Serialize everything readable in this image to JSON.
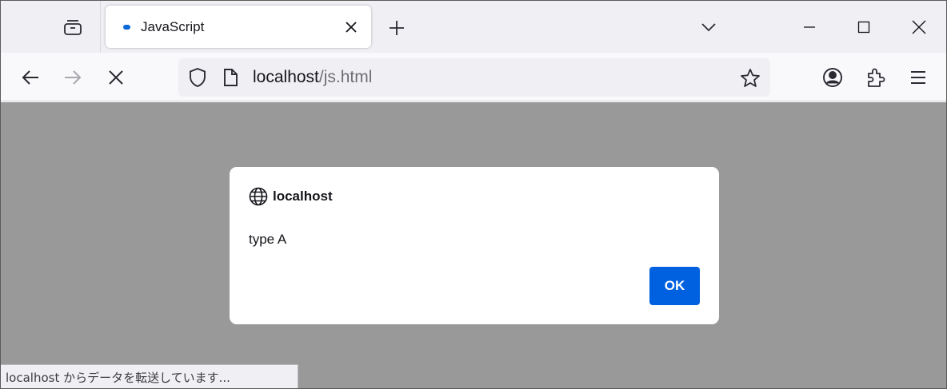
{
  "tab": {
    "title": "JavaScript"
  },
  "url": {
    "host": "localhost",
    "path": "/js.html"
  },
  "dialog": {
    "origin": "localhost",
    "message": "type A",
    "ok_label": "OK"
  },
  "status": {
    "text": "localhost からデータを転送しています..."
  },
  "colors": {
    "accent": "#0061e0",
    "loading": "#0b68d9",
    "overlay": "#999999",
    "tabbar": "#f0f0f4"
  },
  "icons": [
    "tab-list-icon",
    "loading-dot-icon",
    "close-icon",
    "plus-icon",
    "chevron-down-icon",
    "minimize-icon",
    "maximize-icon",
    "window-close-icon",
    "back-arrow-icon",
    "forward-arrow-icon",
    "stop-icon",
    "shield-icon",
    "page-icon",
    "star-icon",
    "account-icon",
    "extensions-icon",
    "menu-icon",
    "globe-icon"
  ]
}
